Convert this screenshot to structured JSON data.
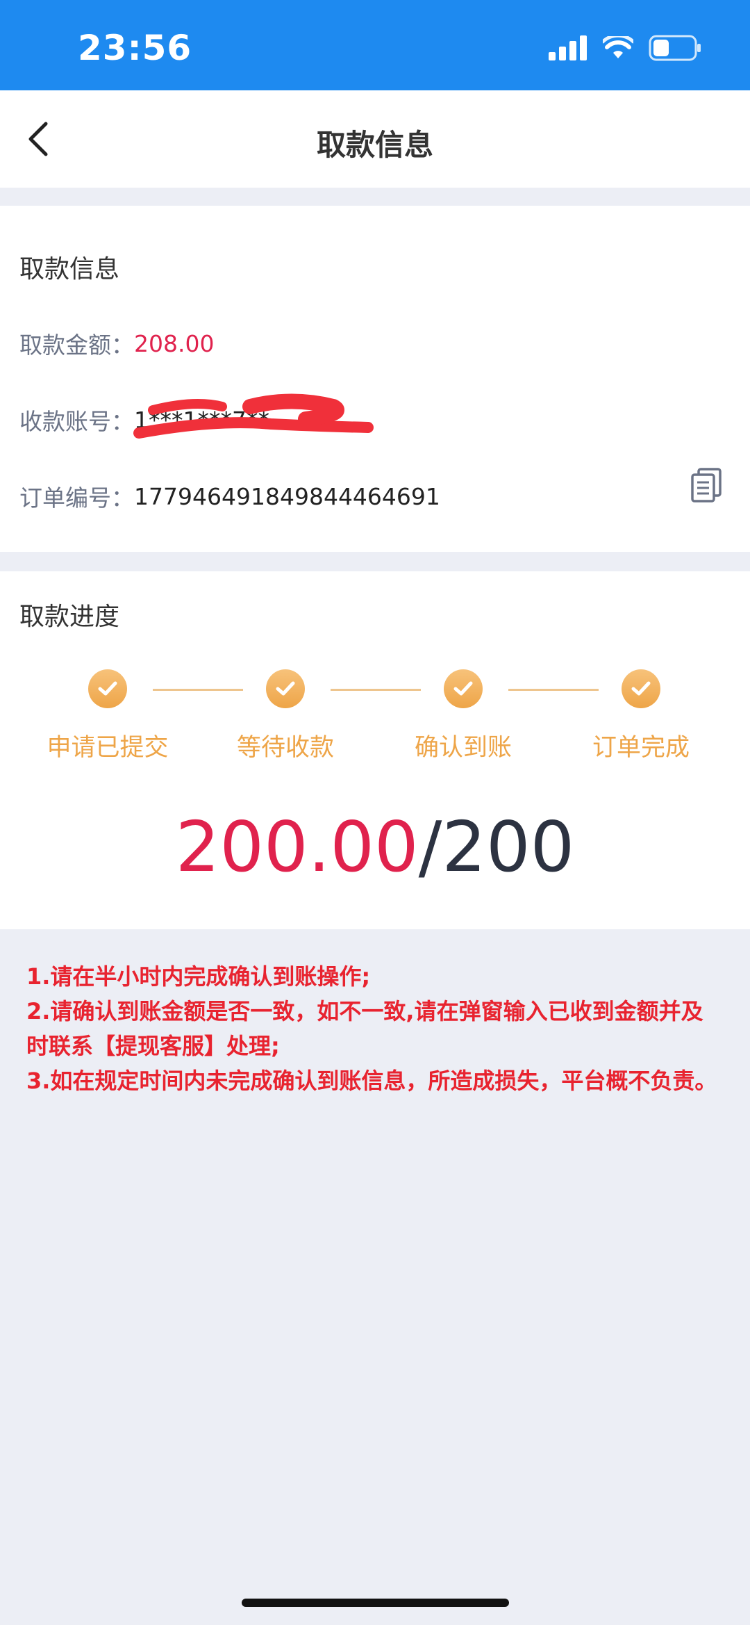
{
  "status_bar": {
    "time": "23:56"
  },
  "nav": {
    "title": "取款信息"
  },
  "info": {
    "section_title": "取款信息",
    "amount_label": "取款金额：",
    "amount_value": "208.00",
    "account_label": "收款账号：",
    "account_value": "1***1***7**",
    "order_label": "订单编号：",
    "order_value": "177946491849844464691"
  },
  "progress": {
    "section_title": "取款进度",
    "steps": [
      {
        "label": "申请已提交"
      },
      {
        "label": "等待收款"
      },
      {
        "label": "确认到账"
      },
      {
        "label": "订单完成"
      }
    ],
    "received": "200.00",
    "separator": "/",
    "total": "200"
  },
  "notes": [
    "1.请在半小时内完成确认到账操作;",
    "2.请确认到账金额是否一致，如不一致,请在弹窗输入已收到金额并及时联系【提现客服】处理;",
    "3.如在规定时间内未完成确认到账信息，所造成损失，平台概不负责。"
  ],
  "colors": {
    "status_bar": "#1e8af0",
    "accent_red": "#e0224d",
    "step_orange": "#eea548",
    "notes_red": "#e8232f"
  }
}
